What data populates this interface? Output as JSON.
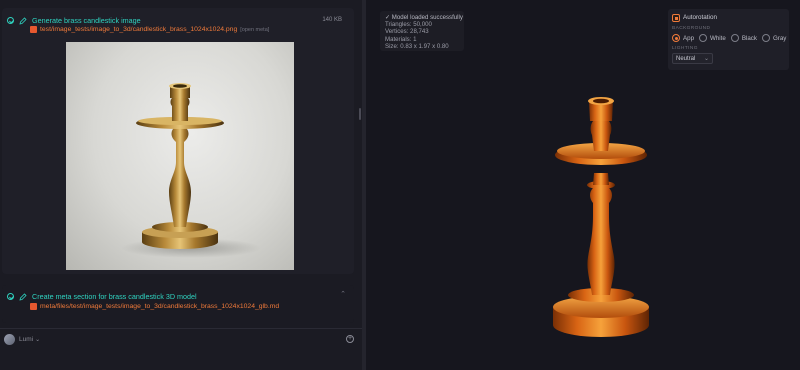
{
  "chat": {
    "task1": {
      "title": "Generate brass candlestick image",
      "size": "140 KB",
      "file": "test/image_tests/image_to_3d/candlestick_brass_1024x1024.png",
      "open_meta": "[open meta]"
    },
    "task2": {
      "title": "Create meta section for brass candlestick 3D model",
      "file": "meta/files/test/image_tests/image_to_3d/candlestick_brass_1024x1024_glb.md"
    },
    "composer": {
      "user": "Lumi",
      "user_chevron": "⌄"
    }
  },
  "viewer": {
    "stats": {
      "status": "✓ Model loaded successfully",
      "triangles": "Triangles: 50,000",
      "vertices": "Vertices: 28,743",
      "materials": "Materials: 1",
      "size": "Size: 0.83 x 1.97 x 0.80"
    },
    "controls": {
      "autorotation_label": "Autorotation",
      "autorotation_checked": true,
      "background_heading": "BACKGROUND",
      "background_options": [
        "App",
        "White",
        "Black",
        "Gray"
      ],
      "background_selected": "App",
      "lighting_heading": "LIGHTING",
      "lighting_value": "Neutral"
    }
  },
  "colors": {
    "accent": "#f07a3a",
    "task_title": "#2fd3c0",
    "file_link": "#f07a3a",
    "background": "#17171f"
  }
}
